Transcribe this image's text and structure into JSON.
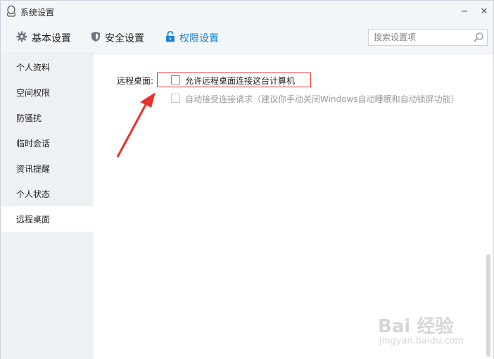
{
  "window": {
    "title": "系统设置",
    "minimize_glyph": "−",
    "close_glyph": "✕"
  },
  "nav": {
    "tabs": [
      {
        "label": "基本设置",
        "icon": "gear-icon"
      },
      {
        "label": "安全设置",
        "icon": "shield-icon"
      },
      {
        "label": "权限设置",
        "icon": "lock-icon",
        "active": true
      }
    ],
    "search_placeholder": "搜索设置项"
  },
  "sidebar": {
    "items": [
      {
        "label": "个人资料"
      },
      {
        "label": "空间权限"
      },
      {
        "label": "防骚扰"
      },
      {
        "label": "临时会话"
      },
      {
        "label": "资讯提醒"
      },
      {
        "label": "个人状态"
      },
      {
        "label": "远程桌面",
        "active": true
      }
    ]
  },
  "main": {
    "section_label": "远程桌面:",
    "options": [
      {
        "label": "允许远程桌面连接这台计算机",
        "checked": false,
        "enabled": true
      },
      {
        "label": "自动接受连接请求（建议你手动关闭Windows自动睡眠和自动锁屏功能）",
        "checked": false,
        "enabled": false
      }
    ]
  },
  "colors": {
    "accent": "#1a84d9",
    "highlight": "#e8322c",
    "sidebar_bg": "#eef1f4"
  },
  "watermark": {
    "logo": "Bai 经验",
    "sub": "jingyan.baidu.com"
  }
}
